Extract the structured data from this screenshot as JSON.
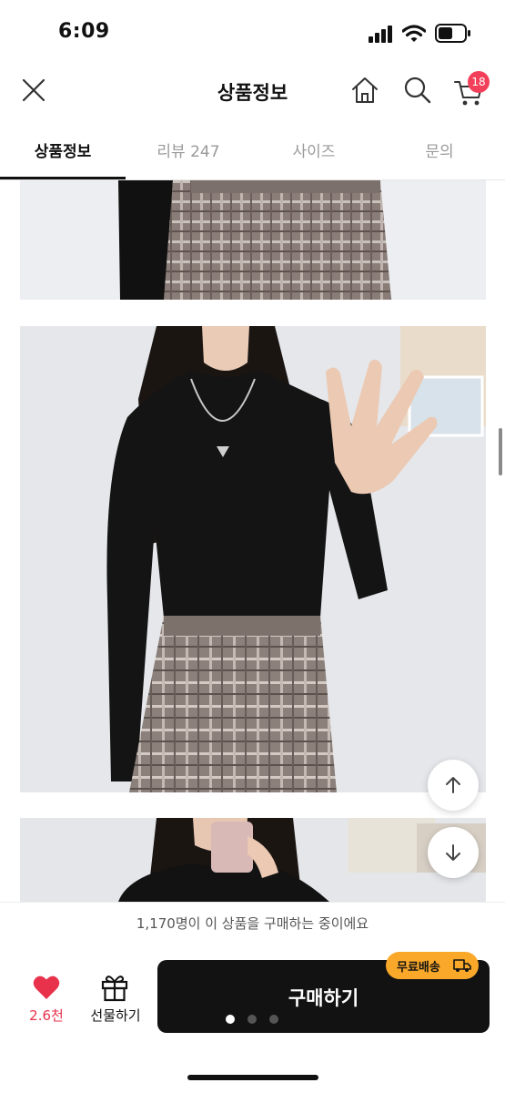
{
  "status_bar": {
    "time": "6:09",
    "signal_icon": "cellular-signal-icon",
    "wifi_icon": "wifi-icon",
    "battery_icon": "battery-icon"
  },
  "header": {
    "title": "상품정보",
    "close_icon": "close-icon",
    "home_icon": "home-icon",
    "search_icon": "search-icon",
    "cart_icon": "cart-icon",
    "cart_badge": "18",
    "badge_color": "#f3405a"
  },
  "tabs": [
    {
      "label": "상품정보",
      "active": true
    },
    {
      "label": "리뷰 247",
      "active": false
    },
    {
      "label": "사이즈",
      "active": false
    },
    {
      "label": "문의",
      "active": false
    }
  ],
  "floating_buttons": {
    "scroll_up_icon": "arrow-up-icon",
    "scroll_down_icon": "arrow-down-icon"
  },
  "notice": {
    "text": "1,170명이 이 상품을 구매하는 중이에요"
  },
  "bottom_bar": {
    "like_icon": "heart-icon",
    "like_count": "2.6천",
    "like_color": "#e8324b",
    "gift_icon": "gift-icon",
    "gift_label": "선물하기",
    "buy_label": "구매하기",
    "shipping_badge": "무료배송",
    "shipping_icon": "truck-icon",
    "shipping_color": "#f9a82a",
    "page_dots": {
      "count": 3,
      "active_index": 0
    }
  }
}
